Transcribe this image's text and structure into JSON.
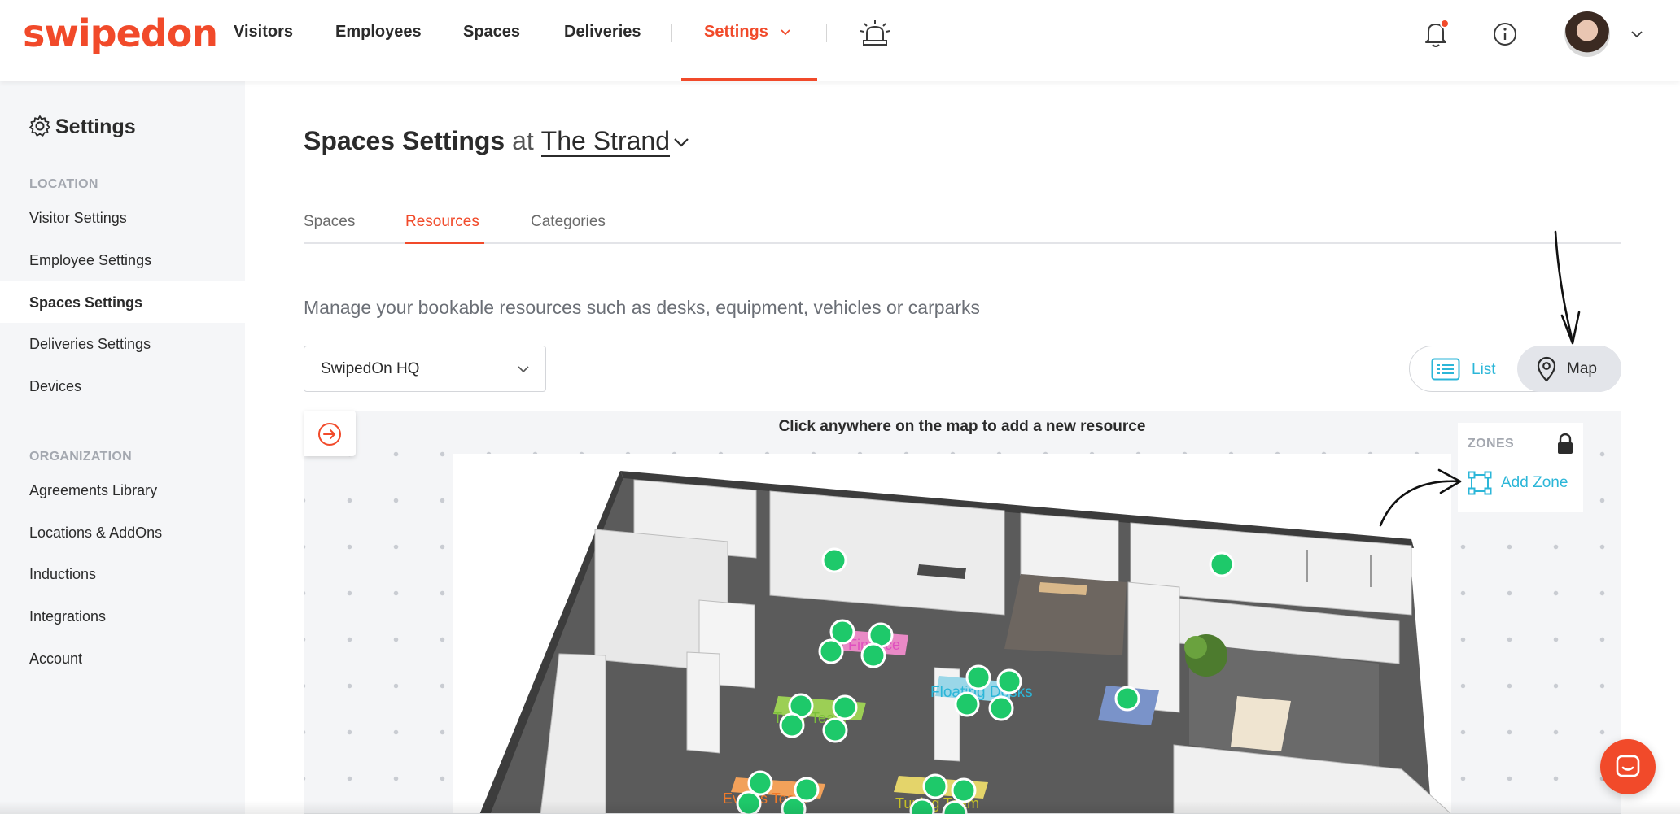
{
  "brand": {
    "logo_text": "swipedon",
    "accent": "#f14a2a",
    "link": "#2bb6d8",
    "pin": "#1ec96a"
  },
  "topnav": {
    "items": [
      {
        "label": "Visitors"
      },
      {
        "label": "Employees"
      },
      {
        "label": "Spaces"
      },
      {
        "label": "Deliveries"
      },
      {
        "label": "Settings"
      }
    ],
    "icons": [
      "evacuation-alarm-icon",
      "bell-icon",
      "info-icon",
      "avatar",
      "chevron-down-icon"
    ]
  },
  "sidebar": {
    "title": "Settings",
    "section_location": "LOCATION",
    "location_items": [
      {
        "label": "Visitor Settings"
      },
      {
        "label": "Employee Settings"
      },
      {
        "label": "Spaces Settings"
      },
      {
        "label": "Deliveries Settings"
      },
      {
        "label": "Devices"
      }
    ],
    "section_organization": "ORGANIZATION",
    "org_items": [
      {
        "label": "Agreements Library"
      },
      {
        "label": "Locations & AddOns"
      },
      {
        "label": "Inductions"
      },
      {
        "label": "Integrations"
      },
      {
        "label": "Account"
      }
    ],
    "active": "Spaces Settings"
  },
  "main": {
    "title": "Spaces Settings",
    "title_at": "at",
    "location": "The Strand",
    "tabs": [
      {
        "label": "Spaces"
      },
      {
        "label": "Resources"
      },
      {
        "label": "Categories"
      }
    ],
    "active_tab": "Resources",
    "description": "Manage your bookable resources such as desks, equipment, vehicles or carparks",
    "floor_select": "SwipedOn HQ",
    "view_toggle": {
      "list": "List",
      "map": "Map",
      "active": "Map"
    },
    "map": {
      "hint": "Click anywhere on the map to add a new resource",
      "zones_title": "ZONES",
      "add_zone": "Add Zone",
      "zone_labels": [
        {
          "text": "Finance",
          "color": "#e04fbf"
        },
        {
          "text": "Floating Desks",
          "color": "#2bb6d8"
        },
        {
          "text": "Tutor Team",
          "color": "#7bbf3a"
        },
        {
          "text": "Events Team",
          "color": "#f07a2a"
        },
        {
          "text": "Tuning Team",
          "color": "#c9c326"
        }
      ]
    }
  }
}
